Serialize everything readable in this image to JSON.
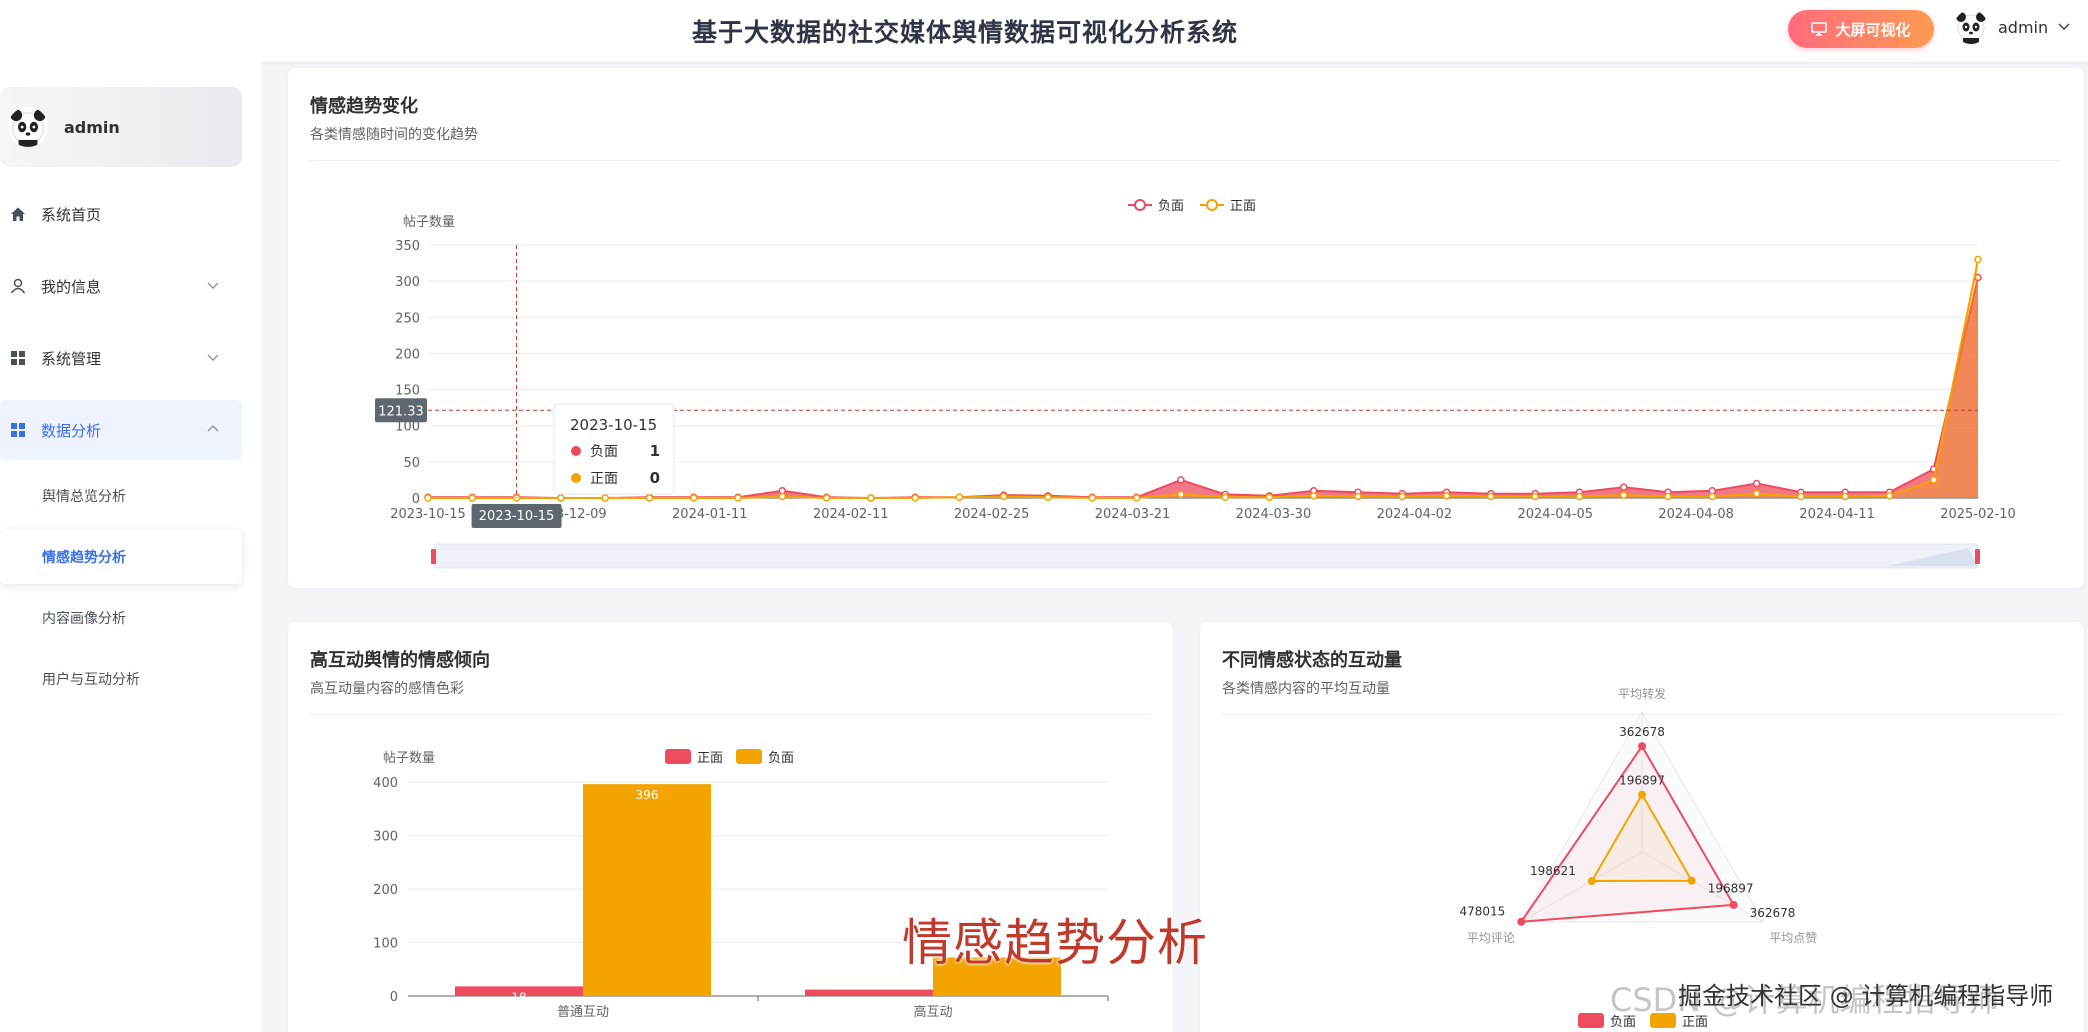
{
  "header": {
    "title": "基于大数据的社交媒体舆情数据可视化分析系统",
    "bigscreen_label": "大屏可视化",
    "username": "admin"
  },
  "sidebar": {
    "user": "admin",
    "items": [
      {
        "label": "系统首页",
        "icon": "home-icon",
        "expandable": false
      },
      {
        "label": "我的信息",
        "icon": "user-icon",
        "expandable": true
      },
      {
        "label": "系统管理",
        "icon": "grid-icon",
        "expandable": true
      },
      {
        "label": "数据分析",
        "icon": "grid-icon",
        "expandable": true
      }
    ],
    "sub_items": [
      "舆情总览分析",
      "情感趋势分析",
      "内容画像分析",
      "用户与互动分析"
    ],
    "active_sub": "情感趋势分析"
  },
  "colors": {
    "accent": "#3a6fe6",
    "negative": "#ee4b5f",
    "positive": "#f4a400"
  },
  "trend": {
    "title": "情感趋势变化",
    "subtitle": "各类情感随时间的变化趋势",
    "tooltip": {
      "date": "2023-10-15",
      "rows": [
        {
          "name": "负面",
          "value": "1"
        },
        {
          "name": "正面",
          "value": "0"
        }
      ]
    },
    "crosshair_y_label": "121.33",
    "crosshair_x_label": "2023-10-15"
  },
  "interaction": {
    "title": "高互动舆情的情感倾向",
    "subtitle": "高互动量内容的感情色彩"
  },
  "radar": {
    "title": "不同情感状态的互动量",
    "subtitle": "各类情感内容的平均互动量"
  },
  "overlay": {
    "caption": "情感趋势分析",
    "watermark": "CSDN @计算机编程指导师",
    "watermark2": "掘金技术社区 @ 计算机编程指导师"
  },
  "chart_data": [
    {
      "type": "area",
      "title": "情感趋势变化",
      "ylabel": "帖子数量",
      "ylim": [
        0,
        350
      ],
      "yticks": [
        0,
        50,
        100,
        150,
        200,
        250,
        300,
        350
      ],
      "x_tick_labels": [
        "2023-10-15",
        "2023-12-09",
        "2024-01-11",
        "2024-02-11",
        "2024-02-25",
        "2024-03-21",
        "2024-03-30",
        "2024-04-02",
        "2024-04-05",
        "2024-04-08",
        "2024-04-11",
        "2025-02-10"
      ],
      "legend": [
        "负面",
        "正面"
      ],
      "legend_position": "top-center",
      "series": [
        {
          "name": "负面",
          "values": [
            1,
            1,
            1,
            0,
            0,
            1,
            1,
            1,
            10,
            1,
            0,
            1,
            1,
            4,
            3,
            1,
            1,
            25,
            5,
            3,
            10,
            8,
            6,
            8,
            6,
            6,
            8,
            15,
            8,
            10,
            20,
            8,
            8,
            8,
            40,
            305
          ]
        },
        {
          "name": "正面",
          "values": [
            0,
            0,
            0,
            0,
            0,
            0,
            0,
            0,
            2,
            0,
            0,
            0,
            1,
            2,
            1,
            0,
            0,
            5,
            1,
            1,
            3,
            2,
            2,
            3,
            2,
            2,
            2,
            4,
            2,
            2,
            6,
            2,
            2,
            3,
            25,
            330
          ]
        }
      ]
    },
    {
      "type": "bar",
      "title": "高互动舆情的情感倾向",
      "ylabel": "帖子数量",
      "ylim": [
        0,
        400
      ],
      "yticks": [
        0,
        100,
        200,
        300,
        400
      ],
      "categories": [
        "普通互动",
        "高互动"
      ],
      "legend": [
        "正面",
        "负面"
      ],
      "legend_position": "top-center",
      "series": [
        {
          "name": "正面",
          "values": [
            18,
            12
          ]
        },
        {
          "name": "负面",
          "values": [
            396,
            72
          ]
        }
      ],
      "data_labels": [
        "18",
        "396"
      ]
    },
    {
      "type": "radar",
      "title": "不同情感状态的互动量",
      "indicators": [
        "平均转发",
        "平均点赞",
        "平均评论"
      ],
      "max": 480000,
      "legend": [
        "负面",
        "正面"
      ],
      "legend_position": "bottom-center",
      "series": [
        {
          "name": "负面",
          "values": [
            362678,
            362678,
            478015
          ]
        },
        {
          "name": "正面",
          "values": [
            196897,
            196897,
            198621
          ]
        }
      ]
    }
  ]
}
